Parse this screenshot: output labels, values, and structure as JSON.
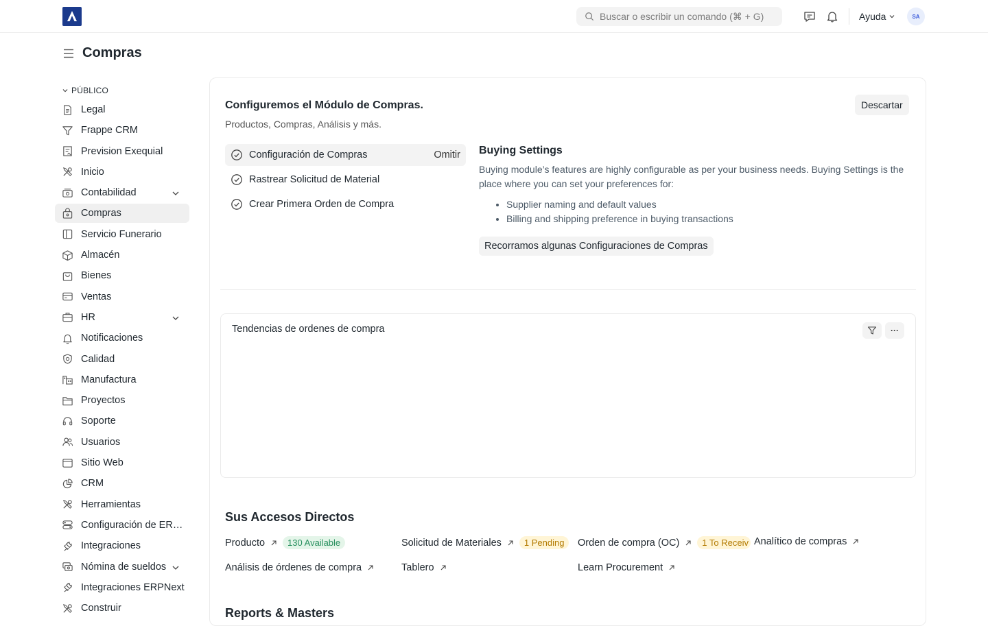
{
  "navbar": {
    "search_placeholder": "Buscar o escribir un comando (⌘ + G)",
    "help_label": "Ayuda",
    "avatar_initials": "SA"
  },
  "page": {
    "title": "Compras"
  },
  "sidebar": {
    "section_label": "PÚBLICO",
    "items": [
      {
        "label": "Legal",
        "icon": "document-icon"
      },
      {
        "label": "Frappe CRM",
        "icon": "filter-icon"
      },
      {
        "label": "Prevision Exequial",
        "icon": "form-icon"
      },
      {
        "label": "Inicio",
        "icon": "tools-icon"
      },
      {
        "label": "Contabilidad",
        "icon": "accounting-icon"
      },
      {
        "label": "Compras",
        "icon": "buying-icon"
      },
      {
        "label": "Servicio Funerario",
        "icon": "book-icon"
      },
      {
        "label": "Almacén",
        "icon": "box-icon"
      },
      {
        "label": "Bienes",
        "icon": "bag-icon"
      },
      {
        "label": "Ventas",
        "icon": "card-icon"
      },
      {
        "label": "HR",
        "icon": "briefcase-icon"
      },
      {
        "label": "Notificaciones",
        "icon": "bell-icon"
      },
      {
        "label": "Calidad",
        "icon": "badge-icon"
      },
      {
        "label": "Manufactura",
        "icon": "factory-icon"
      },
      {
        "label": "Proyectos",
        "icon": "folder-icon"
      },
      {
        "label": "Soporte",
        "icon": "headset-icon"
      },
      {
        "label": "Usuarios",
        "icon": "users-icon"
      },
      {
        "label": "Sitio Web",
        "icon": "browser-icon"
      },
      {
        "label": "CRM",
        "icon": "pie-icon"
      },
      {
        "label": "Herramientas",
        "icon": "tools-icon"
      },
      {
        "label": "Configuración de ERPNext",
        "icon": "settings-icon"
      },
      {
        "label": "Integraciones",
        "icon": "plug-icon"
      },
      {
        "label": "Nómina de sueldos",
        "icon": "money-icon"
      },
      {
        "label": "Integraciones ERPNext",
        "icon": "plug-icon"
      },
      {
        "label": "Construir",
        "icon": "tools-icon"
      }
    ]
  },
  "onboarding": {
    "title": "Configuremos el Módulo de Compras.",
    "subtitle": "Productos, Compras, Análisis y más.",
    "dismiss_label": "Descartar",
    "steps": [
      {
        "label": "Configuración de Compras",
        "skip": "Omitir"
      },
      {
        "label": "Rastrear Solicitud de Material",
        "skip": ""
      },
      {
        "label": "Crear Primera Orden de Compra",
        "skip": ""
      }
    ],
    "detail": {
      "title": "Buying Settings",
      "text": "Buying module’s features are highly configurable as per your business needs. Buying Settings is the place where you can set your preferences for:",
      "bullets": [
        "Supplier naming and default values",
        "Billing and shipping preference in buying transactions"
      ],
      "cta": "Recorramos algunas Configuraciones de Compras"
    }
  },
  "chart": {
    "title": "Tendencias de ordenes de compra",
    "more_label": "···"
  },
  "shortcuts": {
    "title": "Sus Accesos Directos",
    "items": [
      {
        "label": "Producto",
        "badge": "130 Available"
      },
      {
        "label": "Solicitud de Materiales",
        "badge": "1 Pending"
      },
      {
        "label": "Orden de compra (OC)",
        "badge": "1 To Receiv"
      },
      {
        "label": "Analítico de compras",
        "badge": ""
      },
      {
        "label": "Análisis de órdenes de compra",
        "badge": ""
      },
      {
        "label": "Tablero",
        "badge": ""
      },
      {
        "label": "Learn Procurement",
        "badge": ""
      }
    ]
  },
  "reports": {
    "title": "Reports & Masters"
  }
}
